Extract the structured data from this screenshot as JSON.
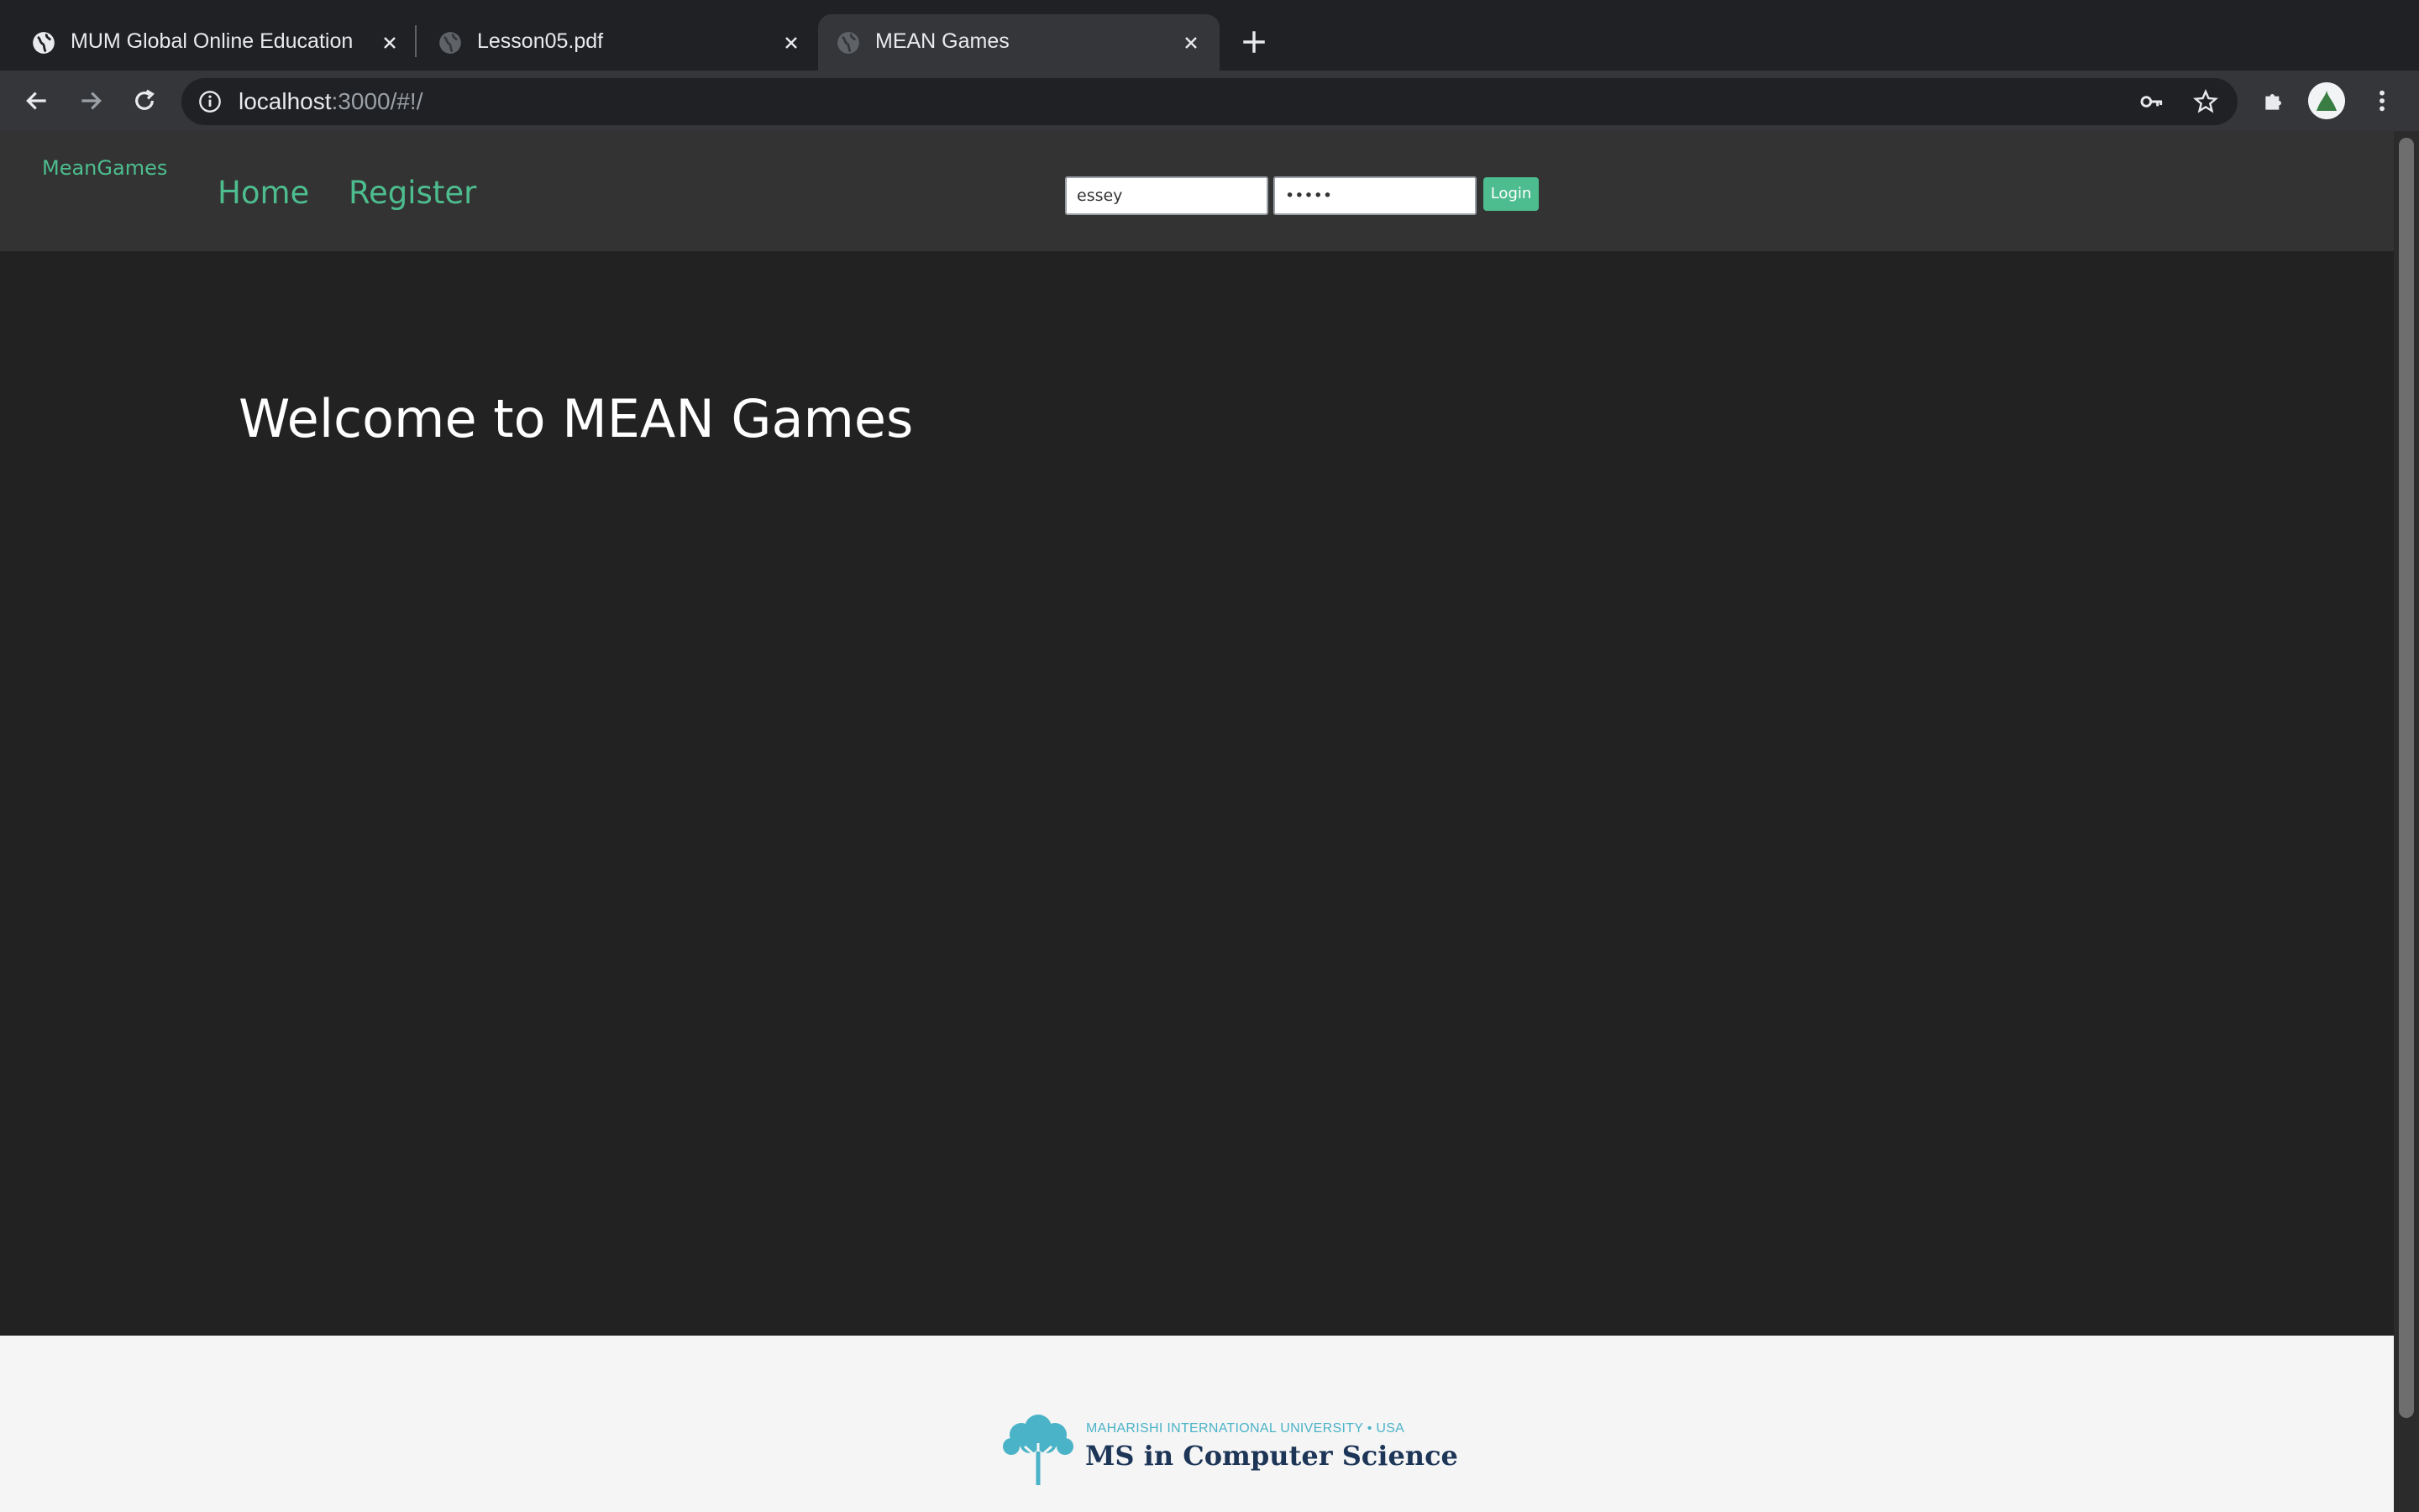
{
  "browser": {
    "tabs": [
      {
        "title": "MUM Global Online Education",
        "active": false,
        "icon": "globe-icon"
      },
      {
        "title": "Lesson05.pdf",
        "active": false,
        "icon": "globe-icon"
      },
      {
        "title": "MEAN Games",
        "active": true,
        "icon": "globe-icon"
      }
    ],
    "url_host": "localhost",
    "url_rest": ":3000/#!/"
  },
  "site": {
    "brand": "MeanGames",
    "nav": {
      "home": "Home",
      "register": "Register"
    },
    "login": {
      "username_value": "essey",
      "password_mask": "•••••",
      "button_label": "Login"
    }
  },
  "main": {
    "heading": "Welcome to MEAN Games"
  },
  "footer": {
    "university": "MAHARISHI INTERNATIONAL UNIVERSITY • USA",
    "program": "MS in Computer Science"
  },
  "colors": {
    "accent": "#4dbd8f",
    "nav_bg": "#333333",
    "page_bg": "#222222"
  }
}
